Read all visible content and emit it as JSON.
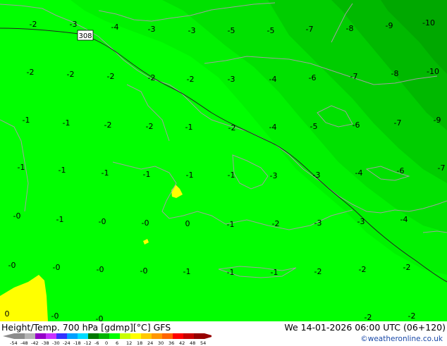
{
  "title": "Height/Temp. 700 hPa [gdmp][°C] GFS",
  "datetime": "We 14-01-2026 06:00 UTC (06+120)",
  "credit": "©weatheronline.co.uk",
  "height_contour_label": "308",
  "colorbar": {
    "ticks": [
      "-54",
      "-48",
      "-42",
      "-38",
      "-30",
      "-24",
      "-18",
      "-12",
      "-6",
      "0",
      "6",
      "12",
      "18",
      "24",
      "30",
      "36",
      "42",
      "48",
      "54"
    ],
    "colors": [
      "#8c8c8c",
      "#b4b4b4",
      "#9600c8",
      "#c832ff",
      "#3232ff",
      "#00a0ff",
      "#00dcff",
      "#007800",
      "#00b400",
      "#00ff00",
      "#c8ff00",
      "#ffff00",
      "#ffc800",
      "#ff9600",
      "#ff6400",
      "#ff0000",
      "#c80000",
      "#960000"
    ]
  },
  "temp_labels": [
    {
      "v": "-2"
    },
    {
      "v": "-3"
    },
    {
      "v": "-4"
    },
    {
      "v": "-3"
    },
    {
      "v": "-3"
    },
    {
      "v": "-5"
    },
    {
      "v": "-5"
    },
    {
      "v": "-7"
    },
    {
      "v": "-8"
    },
    {
      "v": "-9"
    },
    {
      "v": "-10"
    },
    {
      "v": "-2"
    },
    {
      "v": "-2"
    },
    {
      "v": "-2"
    },
    {
      "v": "-2"
    },
    {
      "v": "-2"
    },
    {
      "v": "-3"
    },
    {
      "v": "-4"
    },
    {
      "v": "-6"
    },
    {
      "v": "-7"
    },
    {
      "v": "-8"
    },
    {
      "v": "-10"
    },
    {
      "v": "-1"
    },
    {
      "v": "-1"
    },
    {
      "v": "-2"
    },
    {
      "v": "-2"
    },
    {
      "v": "-1"
    },
    {
      "v": "-2"
    },
    {
      "v": "-4"
    },
    {
      "v": "-5"
    },
    {
      "v": "-6"
    },
    {
      "v": "-7"
    },
    {
      "v": "-9"
    },
    {
      "v": "-1"
    },
    {
      "v": "-1"
    },
    {
      "v": "-1"
    },
    {
      "v": "-1"
    },
    {
      "v": "-1"
    },
    {
      "v": "-1"
    },
    {
      "v": "-3"
    },
    {
      "v": "-3"
    },
    {
      "v": "-4"
    },
    {
      "v": "-6"
    },
    {
      "v": "-7"
    },
    {
      "v": "-0"
    },
    {
      "v": "-1"
    },
    {
      "v": "-0"
    },
    {
      "v": "-0"
    },
    {
      "v": "0"
    },
    {
      "v": "-1"
    },
    {
      "v": "-2"
    },
    {
      "v": "-3"
    },
    {
      "v": "-3"
    },
    {
      "v": "-4"
    },
    {
      "v": "-0"
    },
    {
      "v": "-0"
    },
    {
      "v": "-0"
    },
    {
      "v": "-0"
    },
    {
      "v": "-1"
    },
    {
      "v": "-1"
    },
    {
      "v": "-1"
    },
    {
      "v": "-2"
    },
    {
      "v": "-2"
    },
    {
      "v": "-2"
    },
    {
      "v": "0"
    },
    {
      "v": "-0"
    },
    {
      "v": "-0"
    },
    {
      "v": "-2"
    },
    {
      "v": "-2"
    }
  ]
}
